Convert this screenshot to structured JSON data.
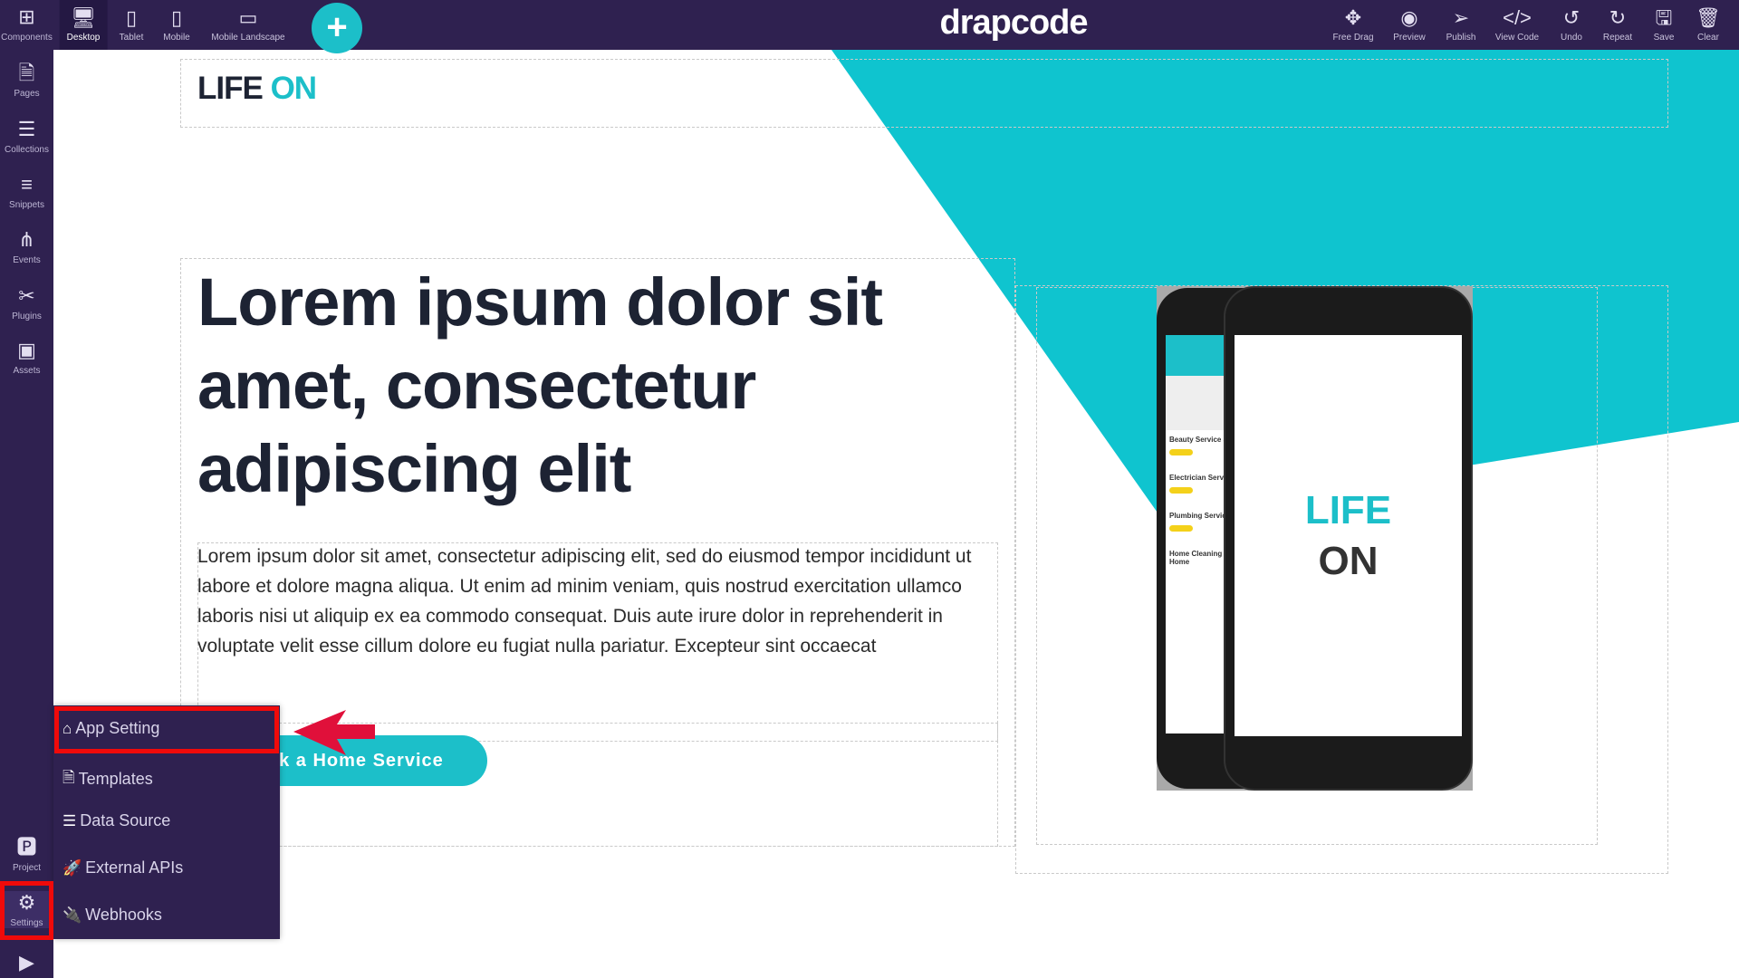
{
  "topbar": {
    "devices": [
      {
        "label": "Desktop",
        "icon": "desktop-icon",
        "active": true
      },
      {
        "label": "Tablet",
        "icon": "tablet-icon"
      },
      {
        "label": "Mobile",
        "icon": "mobile-icon"
      },
      {
        "label": "Mobile Landscape",
        "icon": "mobile-landscape-icon"
      }
    ],
    "add_icon": "plus-circle-icon",
    "brand": "drapcode",
    "actions": [
      {
        "label": "Free Drag",
        "icon": "free-drag-icon"
      },
      {
        "label": "Preview",
        "icon": "eye-icon"
      },
      {
        "label": "Publish",
        "icon": "paper-plane-icon"
      },
      {
        "label": "View Code",
        "icon": "code-icon"
      },
      {
        "label": "Undo",
        "icon": "undo-icon"
      },
      {
        "label": "Repeat",
        "icon": "redo-icon"
      },
      {
        "label": "Save",
        "icon": "save-icon"
      },
      {
        "label": "Clear",
        "icon": "trash-icon"
      }
    ]
  },
  "sidebar": {
    "items": [
      {
        "label": "Components",
        "icon": "plus-square-icon"
      },
      {
        "label": "Pages",
        "icon": "file-icon"
      },
      {
        "label": "Collections",
        "icon": "database-icon"
      },
      {
        "label": "Snippets",
        "icon": "list-icon"
      },
      {
        "label": "Events",
        "icon": "sitemap-icon"
      },
      {
        "label": "Plugins",
        "icon": "tools-icon"
      },
      {
        "label": "Assets",
        "icon": "image-icon"
      }
    ],
    "bottom": [
      {
        "label": "Project",
        "icon": "project-icon"
      },
      {
        "label": "Settings",
        "icon": "gears-icon",
        "active": true
      },
      {
        "label": "",
        "icon": "youtube-icon"
      }
    ]
  },
  "page": {
    "logo_part1": "LIFE",
    "logo_part2": "ON",
    "heading": "Lorem ipsum dolor sit amet, consectetur adipiscing elit",
    "paragraph": "Lorem ipsum dolor sit amet, consectetur adipiscing elit, sed do eiusmod tempor incididunt ut labore et dolore magna aliqua. Ut enim ad minim veniam, quis nostrud exercitation ullamco laboris nisi ut aliquip ex ea commodo consequat. Duis aute irure dolor in reprehenderit in voluptate velit esse cillum dolore eu fugiat nulla pariatur. Excepteur sint occaecat",
    "cta": "Book a Home Service",
    "phone_logo_1": "LIFE",
    "phone_logo_2": "ON",
    "phone_list": [
      "Beauty Service at Home",
      "Electrician Service at Home",
      "Plumbing Service at Home",
      "Home Cleaning Service at Home"
    ]
  },
  "settings_menu": {
    "items": [
      {
        "label": "App Setting",
        "icon": "home-icon",
        "highlighted": true
      },
      {
        "label": "Templates",
        "icon": "file-icon"
      },
      {
        "label": "Data Source",
        "icon": "server-icon"
      },
      {
        "label": "External APIs",
        "icon": "rocket-icon"
      },
      {
        "label": "Webhooks",
        "icon": "plug-icon"
      }
    ]
  },
  "colors": {
    "toolbar": "#2f2150",
    "accent": "#1cbfc9",
    "highlight": "#f00a0a",
    "arrow": "#e0103a"
  }
}
